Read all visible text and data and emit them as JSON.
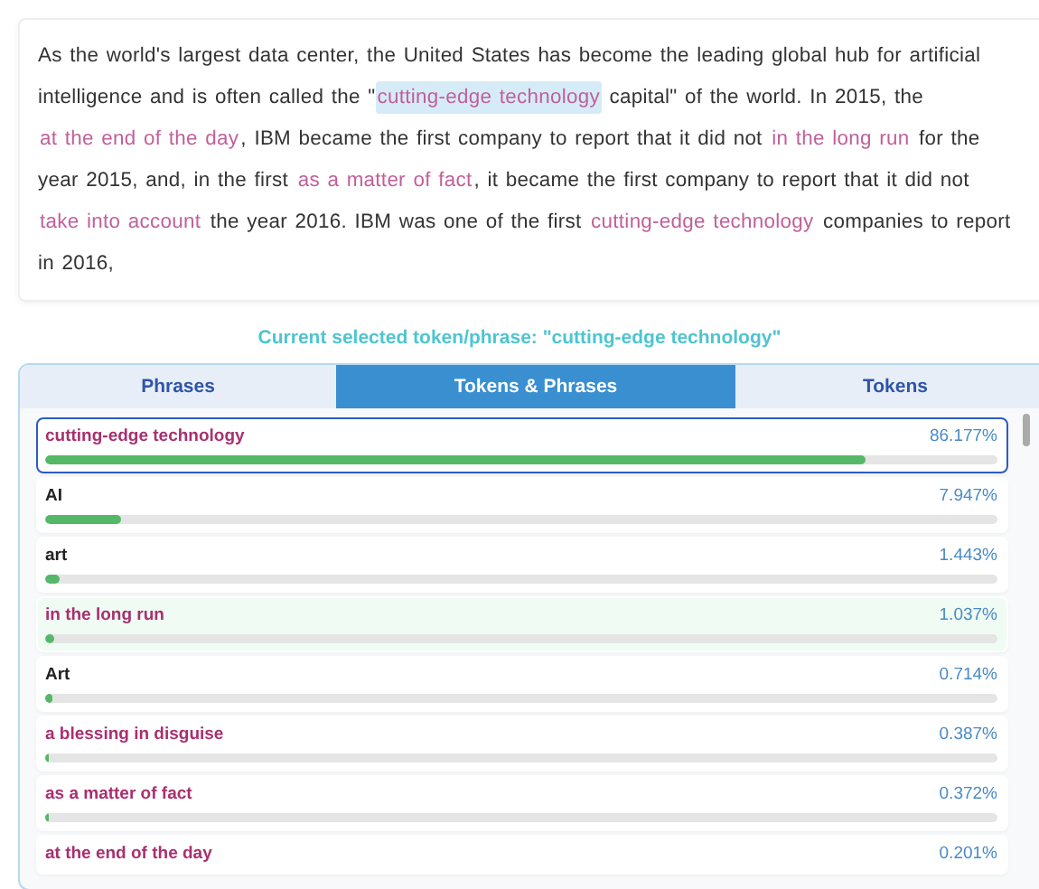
{
  "passage": [
    {
      "kind": "text",
      "text": "As the world's largest data center, the United States has become the leading global hub for artificial intelligence and is often called the \""
    },
    {
      "kind": "phrase",
      "text": "cutting-edge technology",
      "selected": true
    },
    {
      "kind": "text",
      "text": " capital\" of the world. In 2015, the "
    },
    {
      "kind": "phrase",
      "text": "at the end of the day",
      "selected": false
    },
    {
      "kind": "text",
      "text": ", IBM became the first company to report that it did not "
    },
    {
      "kind": "phrase",
      "text": "in the long run",
      "selected": false
    },
    {
      "kind": "text",
      "text": " for the year 2015, and, in the first "
    },
    {
      "kind": "phrase",
      "text": "as a matter of fact",
      "selected": false
    },
    {
      "kind": "text",
      "text": ", it became the first company to report that it did not "
    },
    {
      "kind": "phrase",
      "text": "take into account",
      "selected": false
    },
    {
      "kind": "text",
      "text": " the year 2016. IBM was one of the first "
    },
    {
      "kind": "phrase",
      "text": "cutting-edge technology",
      "selected": false
    },
    {
      "kind": "text",
      "text": " companies to report in 2016,"
    }
  ],
  "caption": "Current selected token/phrase: \"cutting-edge technology\"",
  "tabs": [
    {
      "label": "Phrases",
      "selected": false
    },
    {
      "label": "Tokens & Phrases",
      "selected": true
    },
    {
      "label": "Tokens",
      "selected": false
    }
  ],
  "items": [
    {
      "kind": "phrase",
      "label": "cutting-edge technology",
      "value": "86.177%",
      "level": 0.86177,
      "selected": true,
      "highlighted": false
    },
    {
      "kind": "token",
      "label": "AI",
      "value": "7.947%",
      "level": 0.07947,
      "selected": false,
      "highlighted": false
    },
    {
      "kind": "token",
      "label": "art",
      "value": "1.443%",
      "level": 0.01443,
      "selected": false,
      "highlighted": false
    },
    {
      "kind": "phrase",
      "label": "in the long run",
      "value": "1.037%",
      "level": 0.01037,
      "selected": false,
      "highlighted": true
    },
    {
      "kind": "token",
      "label": "Art",
      "value": "0.714%",
      "level": 0.00714,
      "selected": false,
      "highlighted": false
    },
    {
      "kind": "phrase",
      "label": "a blessing in disguise",
      "value": "0.387%",
      "level": 0.00387,
      "selected": false,
      "highlighted": false
    },
    {
      "kind": "phrase",
      "label": "as a matter of fact",
      "value": "0.372%",
      "level": 0.00372,
      "selected": false,
      "highlighted": false
    },
    {
      "kind": "phrase",
      "label": "at the end of the day",
      "value": "0.201%",
      "selected": false,
      "highlighted": false
    }
  ]
}
